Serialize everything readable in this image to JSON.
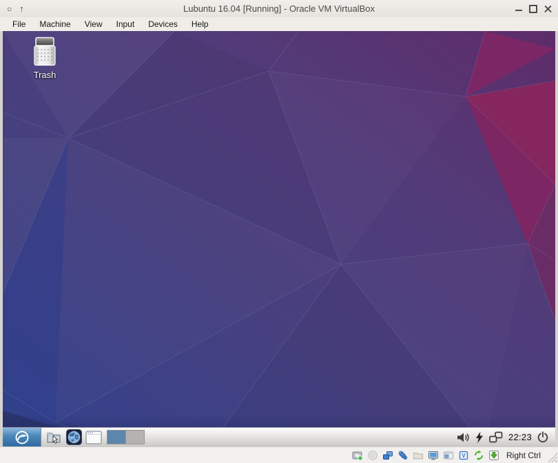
{
  "window": {
    "title": "Lubuntu 16.04 [Running] - Oracle VM VirtualBox",
    "left_controls": {
      "menu_glyph": "○",
      "shade_glyph": "↑"
    }
  },
  "menubar": {
    "items": [
      "File",
      "Machine",
      "View",
      "Input",
      "Devices",
      "Help"
    ]
  },
  "desktop": {
    "trash_label": "Trash",
    "wallpaper_colors": {
      "blue": "#33428d",
      "purple": "#513a79",
      "magenta": "#85265f",
      "navy_edge": "#2a3468"
    }
  },
  "taskbar": {
    "clock": "22:23",
    "workspaces": {
      "count": 2,
      "active_index": 0
    },
    "app_buttons": [
      "file-manager",
      "web-browser",
      "show-desktop"
    ],
    "tray_icons": [
      "volume",
      "battery",
      "network",
      "power"
    ]
  },
  "statusbar": {
    "host_key": "Right Ctrl",
    "chip_letter": "V",
    "device_icons": [
      "hard-disks",
      "optical-drives",
      "network-adapters",
      "usb-devices",
      "shared-folders",
      "display",
      "video-capture",
      "virtualization-features",
      "mouse-integration",
      "keyboard-capture"
    ]
  },
  "colors": {
    "titlebar_bg": "#edebe7",
    "menubar_bg": "#f0ede8",
    "panel_bg": "#dcdad7",
    "statusbar_bg": "#f1f0ee",
    "start_button_blue": "#3d7ab0",
    "active_workspace_blue": "#5d86ad"
  }
}
